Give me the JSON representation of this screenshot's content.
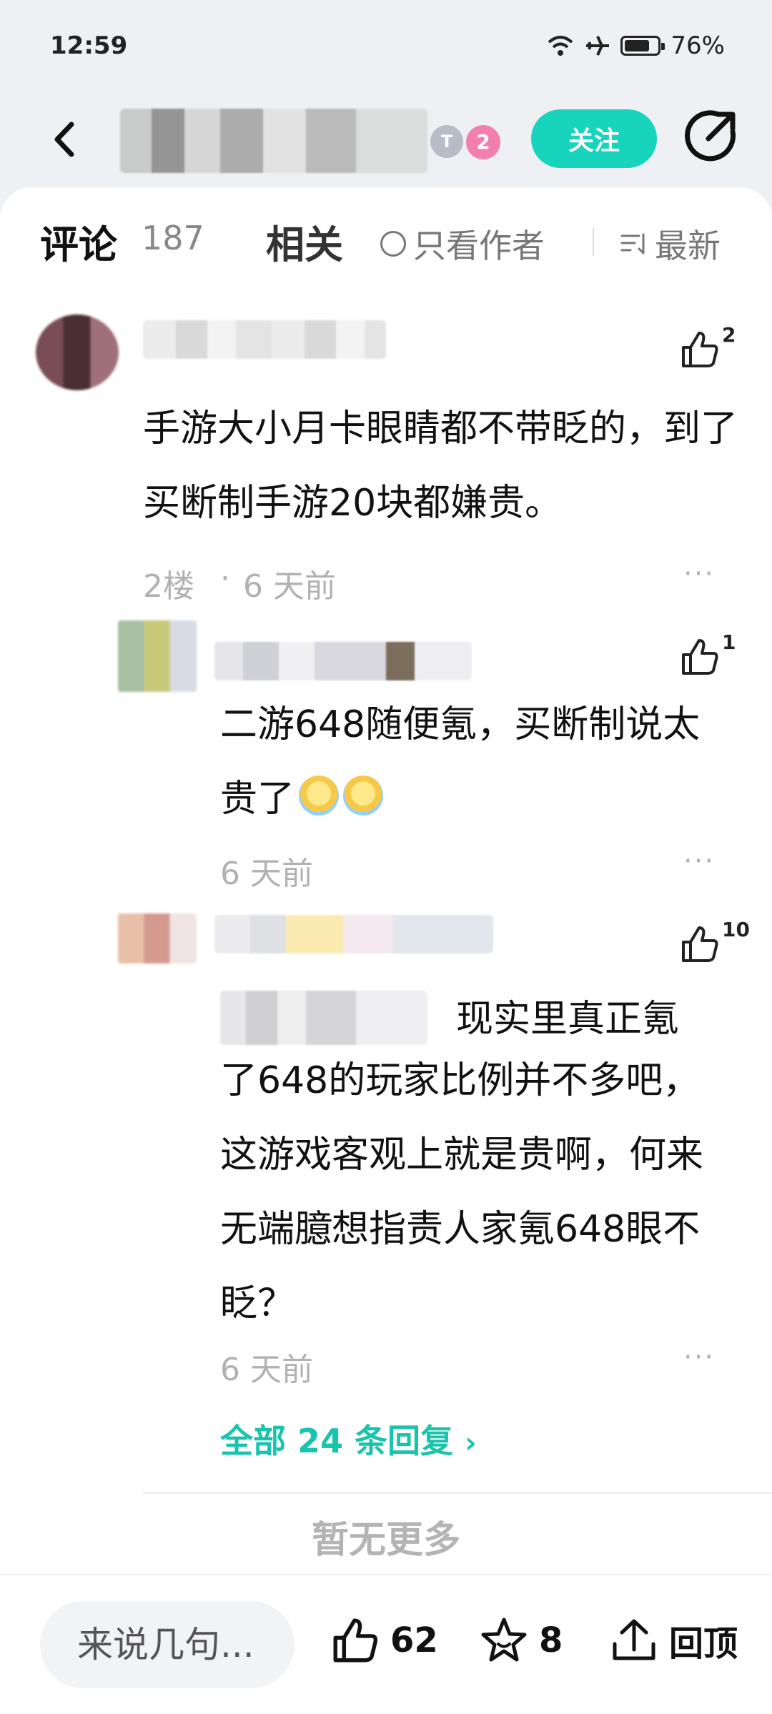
{
  "status_bar": {
    "time": "12:59",
    "battery_percent": "76%",
    "battery_level": 0.76
  },
  "header": {
    "badge_t": "T",
    "badge_level": "2",
    "follow_label": "关注"
  },
  "tabs": {
    "comments_label": "评论",
    "comments_count": "187",
    "related_label": "相关",
    "author_only_label": "只看作者",
    "sort_label": "最新"
  },
  "comments": [
    {
      "text": "手游大小月卡眼睛都不带眨的，到了买断制手游20块都嫌贵。",
      "floor": "2楼",
      "time": "6 天前",
      "likes": "2"
    },
    {
      "text": "二游648随便氪，买断制说太贵了",
      "time": "6 天前",
      "likes": "1"
    },
    {
      "text_first_line": "现实里真正氪",
      "text": "了648的玩家比例并不多吧，这游戏客观上就是贵啊，何来无端臆想指责人家氪648眼不眨？",
      "time": "6 天前",
      "likes": "10"
    }
  ],
  "all_replies_label": "全部 24 条回复",
  "no_more_label": "暂无更多",
  "bottom_bar": {
    "input_placeholder": "来说几句...",
    "likes": "62",
    "favorites": "8",
    "back_top_label": "回顶"
  },
  "colors": {
    "accent": "#18d4bd",
    "link": "#19c3ac",
    "badge_pink": "#f37fae"
  }
}
